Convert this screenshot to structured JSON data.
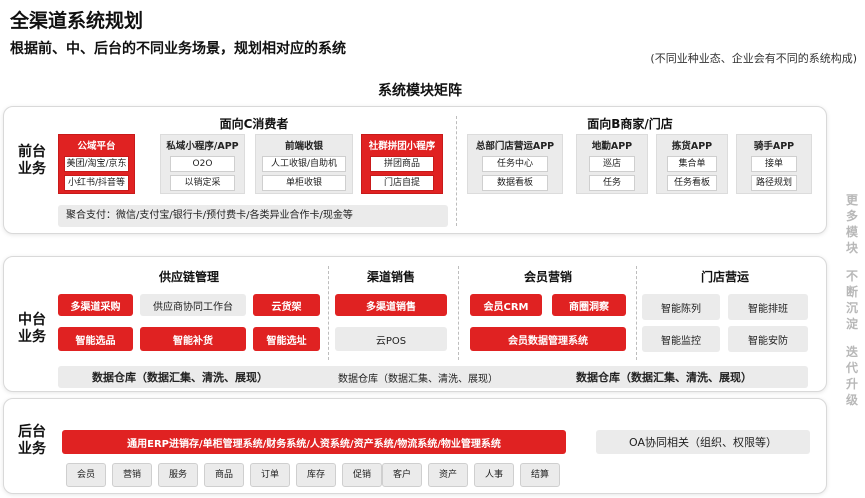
{
  "header": {
    "title": "全渠道系统规划",
    "subtitle": "根据前、中、后台的不同业务场景，规划相对应的系统",
    "note": "(不同业种业态、企业会有不同的系统构成)"
  },
  "matrix_title": "系统模块矩阵",
  "front": {
    "label_line1": "前台",
    "label_line2": "业务",
    "c_title": "面向C消费者",
    "b_title": "面向B商家/门店",
    "c_cards": [
      {
        "title": "公域平台",
        "items": [
          "美团/淘宝/京东",
          "小红书/抖音等"
        ]
      },
      {
        "title": "私域小程序/APP",
        "items": [
          "O2O",
          "以销定采"
        ]
      },
      {
        "title": "前端收银",
        "items": [
          "人工收银/自助机",
          "单柜收银"
        ]
      },
      {
        "title": "社群拼团小程序",
        "items": [
          "拼团商品",
          "门店自提"
        ]
      }
    ],
    "b_cards": [
      {
        "title": "总部门店营运APP",
        "items": [
          "任务中心",
          "数据看板"
        ]
      },
      {
        "title": "地勤APP",
        "items": [
          "巡店",
          "任务"
        ]
      },
      {
        "title": "拣货APP",
        "items": [
          "集合单",
          "任务看板"
        ]
      },
      {
        "title": "骑手APP",
        "items": [
          "接单",
          "路径规划"
        ]
      }
    ],
    "payment": "聚合支付：微信/支付宝/银行卡/预付费卡/各类异业合作卡/现金等"
  },
  "middle": {
    "label_line1": "中台",
    "label_line2": "业务",
    "supply": {
      "title": "供应链管理",
      "row1": [
        "多渠道采购",
        "供应商协同工作台",
        "云货架"
      ],
      "row2": [
        "智能选品",
        "智能补货",
        "智能选址"
      ],
      "dwh": "数据仓库（数据汇集、清洗、展现）"
    },
    "channel": {
      "title": "渠道销售",
      "row1": [
        "多渠道销售"
      ],
      "row2": [
        "云POS"
      ],
      "dwh": "数据仓库（数据汇集、清洗、展现）"
    },
    "member": {
      "title": "会员营销",
      "row1": [
        "会员CRM",
        "商圈洞察"
      ],
      "row2": [
        "会员数据管理系统"
      ],
      "dwh": "数据仓库（数据汇集、清洗、展现）"
    },
    "store": {
      "title": "门店营运",
      "row1": [
        "智能陈列",
        "智能排班"
      ],
      "row2": [
        "智能监控",
        "智能安防"
      ]
    }
  },
  "back": {
    "label_line1": "后台",
    "label_line2": "业务",
    "erp": "通用ERP进销存/单柜管理系统/财务系统/人资系统/资产系统/物流系统/物业管理系统",
    "oa": "OA协同相关（组织、权限等）",
    "modules": [
      "会员",
      "营销",
      "服务",
      "商品",
      "订单",
      "库存",
      "促销",
      "客户",
      "资产",
      "人事",
      "结算"
    ]
  },
  "side_note": [
    "更",
    "多",
    "模",
    "块",
    "",
    "不",
    "断",
    "沉",
    "淀",
    "",
    "迭",
    "代",
    "升",
    "级"
  ],
  "colors": {
    "accent_red": "#e02222",
    "gray_fill": "#ebebeb",
    "side_text": "#b8b8b8"
  }
}
